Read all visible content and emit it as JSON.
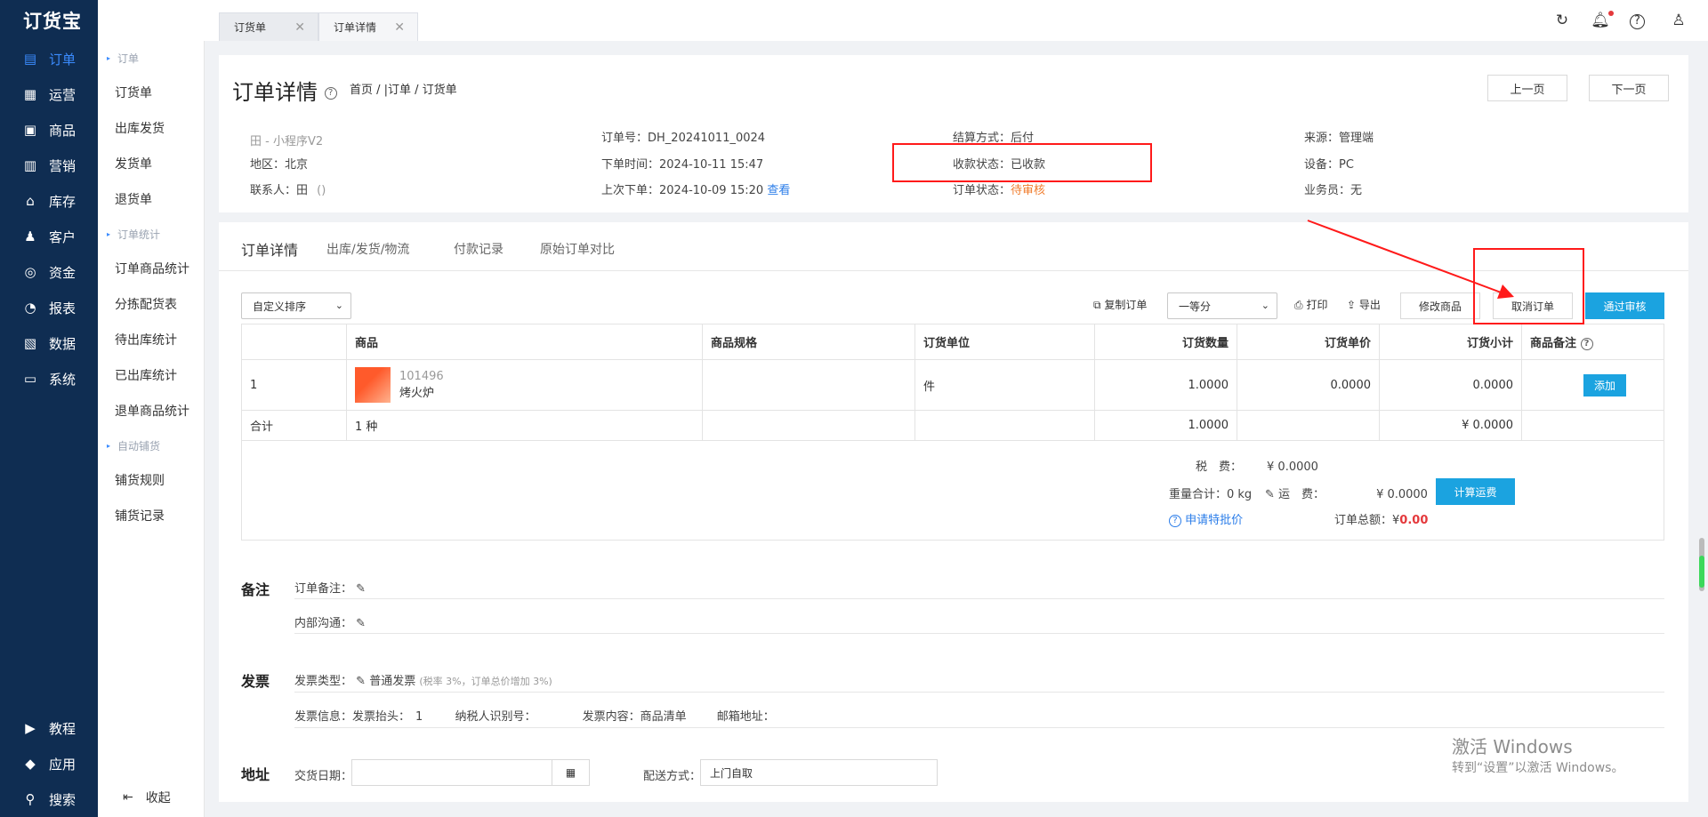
{
  "nav": {
    "logo": "订货宝",
    "items": [
      {
        "label": "订单",
        "icon": "order-icon",
        "glyph": "▤"
      },
      {
        "label": "运营",
        "icon": "operation-icon",
        "glyph": "▦"
      },
      {
        "label": "商品",
        "icon": "goods-icon",
        "glyph": "▣"
      },
      {
        "label": "营销",
        "icon": "marketing-icon",
        "glyph": "▥"
      },
      {
        "label": "库存",
        "icon": "stock-icon",
        "glyph": "⌂"
      },
      {
        "label": "客户",
        "icon": "customer-icon",
        "glyph": "♟"
      },
      {
        "label": "资金",
        "icon": "money-icon",
        "glyph": "◎"
      },
      {
        "label": "报表",
        "icon": "report-icon",
        "glyph": "◔"
      },
      {
        "label": "数据",
        "icon": "data-icon",
        "glyph": "▧"
      },
      {
        "label": "系统",
        "icon": "system-icon",
        "glyph": "▭"
      }
    ],
    "bottom": [
      {
        "label": "教程",
        "icon": "tutorial-icon",
        "glyph": "▶"
      },
      {
        "label": "应用",
        "icon": "app-icon",
        "glyph": "◆"
      },
      {
        "label": "搜索",
        "icon": "search-icon",
        "glyph": "⚲"
      }
    ]
  },
  "sub": {
    "group1": "订单",
    "links1": [
      "订货单",
      "出库发货",
      "发货单",
      "退货单"
    ],
    "group2": "订单统计",
    "links2": [
      "订单商品统计",
      "分拣配货表",
      "待出库统计",
      "已出库统计",
      "退单商品统计"
    ],
    "group3": "自动铺货",
    "links3": [
      "铺货规则",
      "铺货记录"
    ],
    "collapse": "收起"
  },
  "tabs": [
    {
      "label": "订货单"
    },
    {
      "label": "订单详情"
    }
  ],
  "header": {
    "title": "订单详情",
    "breadcrumb": "首页 / |订单 / 订货单",
    "prev": "上一页",
    "next": "下一页"
  },
  "info": {
    "store": "田 - 小程序V2",
    "region_label": "地区：",
    "region": "北京",
    "contact_label": "联系人：",
    "contact": "田",
    "contact_extra": "()",
    "order_no_label": "订单号：",
    "order_no": "DH_20241011_0024",
    "order_time_label": "下单时间：",
    "order_time": "2024-10-11 15:47",
    "last_order_label": "上次下单：",
    "last_order": "2024-10-09 15:20",
    "view": "查看",
    "settle_label": "结算方式：",
    "settle": "后付",
    "pay_status_label": "收款状态：",
    "pay_status": "已收款",
    "order_status_label": "订单状态：",
    "order_status": "待审核",
    "source_label": "来源：",
    "source": "管理端",
    "device_label": "设备：",
    "device": "PC",
    "sales_label": "业务员：",
    "sales": "无"
  },
  "detail_tabs": [
    "订单详情",
    "出库/发货/物流",
    "付款记录",
    "原始订单对比"
  ],
  "toolbar": {
    "sort": "自定义排序",
    "copy": "复制订单",
    "level": "一等分",
    "print": "打印",
    "export": "导出",
    "modify": "修改商品",
    "cancel": "取消订单",
    "approve": "通过审核"
  },
  "table": {
    "headers": [
      "",
      "商品",
      "商品规格",
      "订货单位",
      "订货数量",
      "订货单价",
      "订货小计",
      "商品备注"
    ],
    "row": {
      "idx": "1",
      "code": "101496",
      "name": "烤火炉",
      "spec": "",
      "unit": "件",
      "qty": "1.0000",
      "price": "0.0000",
      "subtotal": "0.0000",
      "add": "添加"
    },
    "total": {
      "label": "合计",
      "kinds": "1 种",
      "qty": "1.0000",
      "subtotal": "¥ 0.0000"
    }
  },
  "summary": {
    "tax_label": "税　费：",
    "tax": "¥ 0.0000",
    "weight": "重量合计：0 kg",
    "freight_label": "运　费：",
    "freight": "¥ 0.0000",
    "calc": "计算运费",
    "special": "申请特批价",
    "total_label": "订单总额：",
    "total_prefix": "¥",
    "total": "0.00"
  },
  "remark": {
    "title": "备注",
    "order_label": "订单备注：",
    "internal_label": "内部沟通："
  },
  "invoice": {
    "title": "发票",
    "type_label": "发票类型：",
    "type": "普通发票",
    "type_note": "(税率 3%，订单总价增加 3%)",
    "info_label": "发票信息：",
    "head_label": "发票抬头：",
    "head": "1",
    "taxid_label": "纳税人识别号：",
    "content_label": "发票内容：",
    "content": "商品清单",
    "email_label": "邮箱地址："
  },
  "address": {
    "title": "地址",
    "date_label": "交货日期：",
    "date": "",
    "ship_label": "配送方式：",
    "ship": "上门自取"
  },
  "watermark": {
    "line1": "激活 Windows",
    "line2": "转到“设置”以激活 Windows。"
  }
}
